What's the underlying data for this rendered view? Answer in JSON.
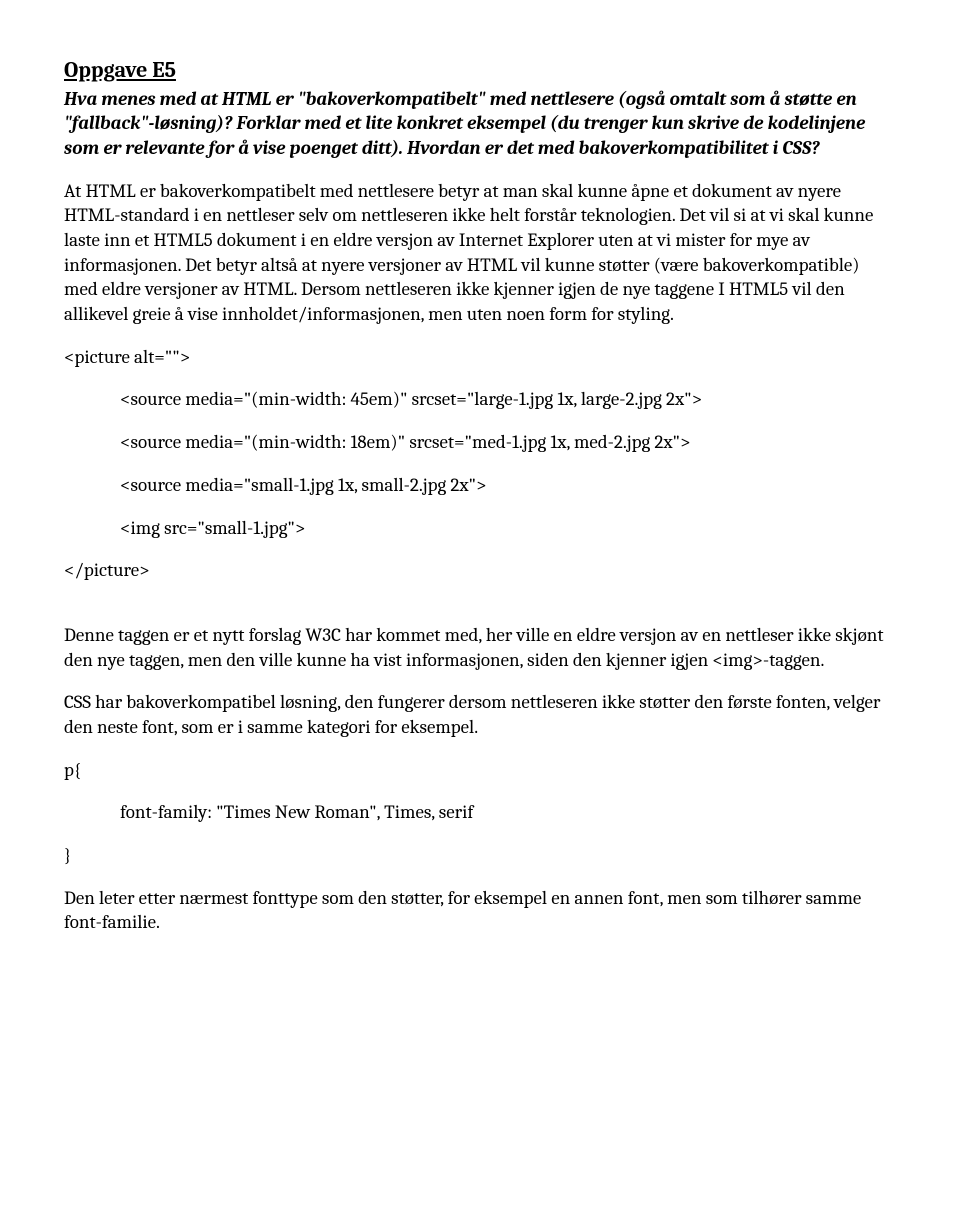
{
  "heading": "Oppgave E5",
  "question": "Hva menes med at HTML er \"bakoverkompatibelt\" med nettlesere (også omtalt som å støtte en \"fallback\"-løsning)? Forklar med et lite konkret eksempel (du trenger kun skrive de kodelinjene som er relevante for å vise poenget ditt). Hvordan er det med bakoverkompatibilitet i CSS?",
  "para1": "At HTML er bakoverkompatibelt med nettlesere betyr at man skal kunne åpne et dokument av nyere HTML-standard i en nettleser selv om nettleseren ikke helt forstår teknologien. Det vil si at vi skal kunne laste inn et HTML5 dokument i en eldre versjon av Internet Explorer uten at vi mister for mye av informasjonen. Det betyr altså at nyere versjoner av HTML vil kunne støtter (være bakoverkompatible) med eldre versjoner av HTML. Dersom nettleseren ikke kjenner igjen de nye taggene I HTML5 vil den allikevel greie å vise innholdet/informasjonen, men uten noen form for styling.",
  "code": {
    "open": "<picture alt=\"\">",
    "l1": "<source media=\"(min-width: 45em)\" srcset=\"large-1.jpg 1x, large-2.jpg 2x\">",
    "l2": "<source media=\"(min-width: 18em)\" srcset=\"med-1.jpg 1x, med-2.jpg 2x\">",
    "l3": "<source media=\"small-1.jpg 1x, small-2.jpg 2x\">",
    "l4": "<img src=\"small-1.jpg\">",
    "close": "</picture>"
  },
  "para2": "Denne taggen er et nytt forslag W3C har kommet med, her ville en eldre versjon av en nettleser ikke skjønt den nye taggen, men den ville kunne ha vist informasjonen, siden den kjenner igjen <img>-taggen.",
  "para3": "CSS har bakoverkompatibel løsning, den fungerer dersom nettleseren ikke støtter den første fonten, velger den neste font, som er  i samme kategori for eksempel.",
  "css": {
    "open": "p{",
    "rule": "font-family: \"Times New Roman\", Times, serif",
    "close": "}"
  },
  "para4": "Den leter etter nærmest fonttype som den støtter, for eksempel en annen font, men som tilhører samme font-familie."
}
